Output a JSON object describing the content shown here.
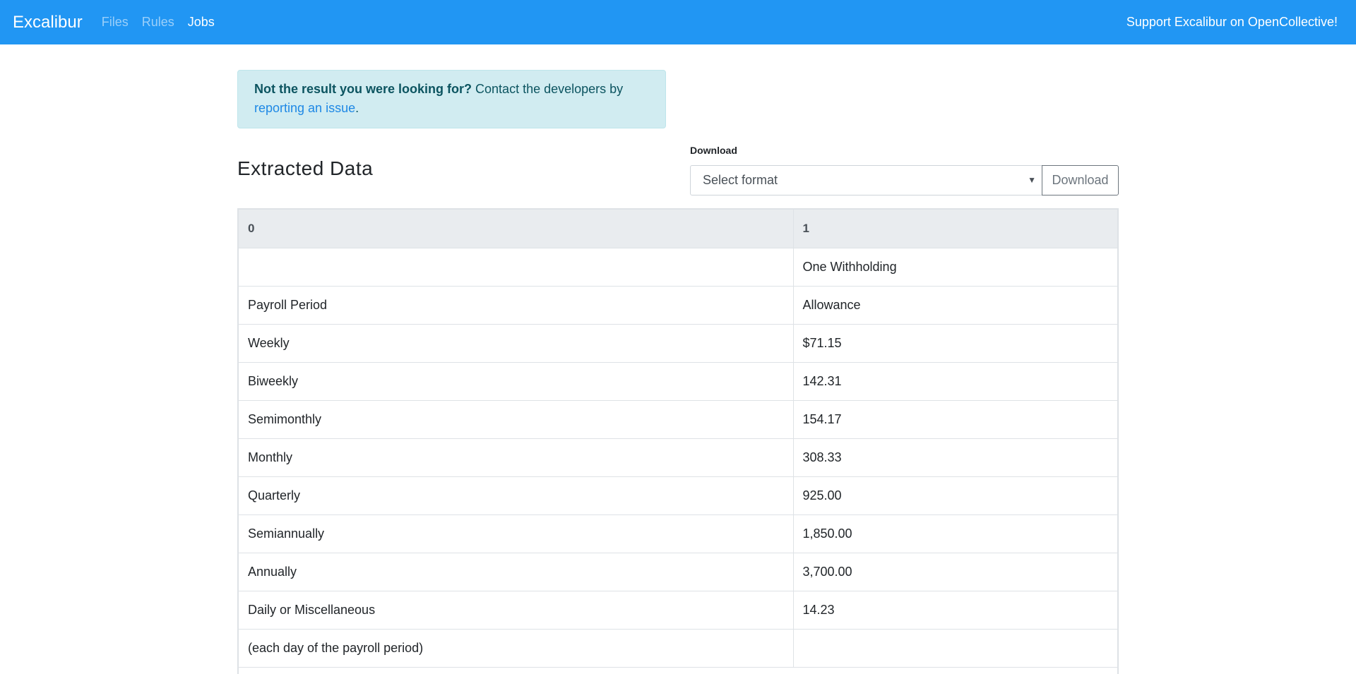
{
  "navbar": {
    "brand": "Excalibur",
    "links": [
      {
        "label": "Files",
        "active": false
      },
      {
        "label": "Rules",
        "active": false
      },
      {
        "label": "Jobs",
        "active": true
      }
    ],
    "support_link": "Support Excalibur on OpenCollective!",
    "bg_color": "#2196f3"
  },
  "alert": {
    "bold_text": "Not the result you were looking for?",
    "text": " Contact the developers by ",
    "link_text": "reporting an issue",
    "end_text": "."
  },
  "section": {
    "title": "Extracted Data"
  },
  "download": {
    "label": "Download",
    "select_value": "Select format",
    "button_label": "Download"
  },
  "table": {
    "headers": [
      "0",
      "1"
    ],
    "rows": [
      [
        "",
        "One Withholding"
      ],
      [
        "Payroll Period",
        "Allowance"
      ],
      [
        "Weekly",
        "$71.15"
      ],
      [
        "Biweekly",
        "142.31"
      ],
      [
        "Semimonthly",
        "154.17"
      ],
      [
        "Monthly",
        "308.33"
      ],
      [
        "Quarterly",
        "925.00"
      ],
      [
        "Semiannually",
        "1,850.00"
      ],
      [
        "Annually",
        "3,700.00"
      ],
      [
        "Daily or Miscellaneous",
        "14.23"
      ],
      [
        "(each day of the payroll period)",
        ""
      ]
    ]
  }
}
